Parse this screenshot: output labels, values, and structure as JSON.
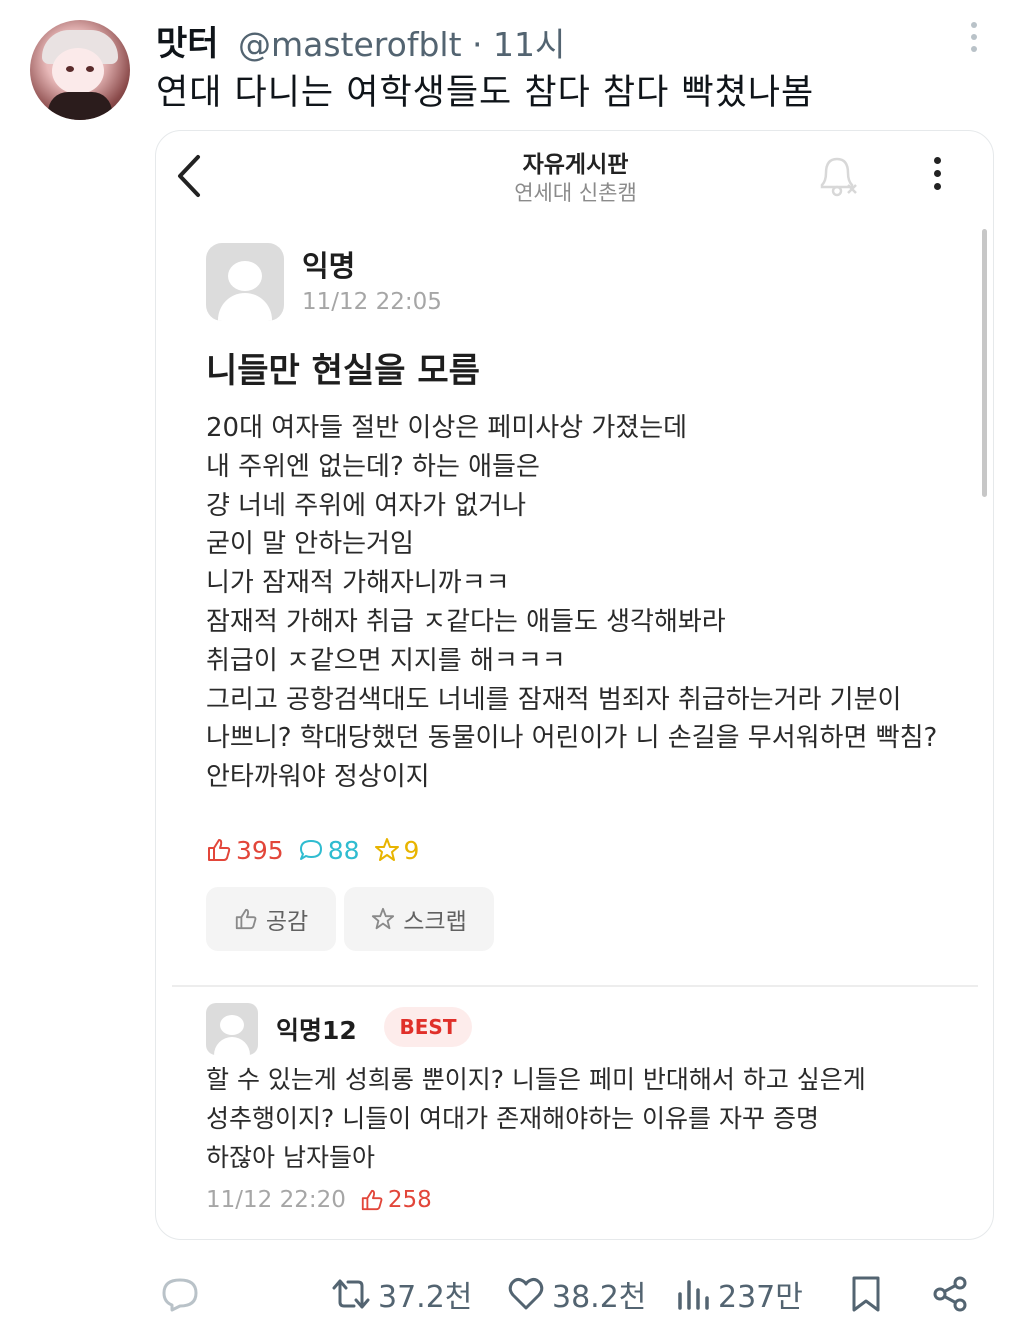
{
  "tweet": {
    "author_name": "맛터",
    "handle_time": "@masterofblt · 11시",
    "text": "연대 다니는 여학생들도 참다 참다 빡쳤나봄",
    "actions": {
      "retweets": "37.2천",
      "likes": "38.2천",
      "views": "237만"
    }
  },
  "screenshot": {
    "header": {
      "title": "자유게시판",
      "subtitle": "연세대 신촌캠"
    },
    "post": {
      "author": "익명",
      "time": "11/12 22:05",
      "title": "니들만 현실을 모름",
      "body_lines": [
        "20대 여자들 절반 이상은 페미사상 가졌는데",
        "내 주위엔 없는데? 하는 애들은",
        "걍 너네 주위에 여자가 없거나",
        "굳이 말 안하는거임",
        "니가 잠재적 가해자니까ㅋㅋ",
        "잠재적 가해자 취급 ㅈ같다는 애들도 생각해봐라",
        "취급이 ㅈ같으면 지지를 해ㅋㅋㅋ",
        "그리고 공항검색대도 너네를 잠재적 범죄자 취급하는거라 기분이",
        "나쁘니? 학대당했던 동물이나 어린이가 니 손길을 무서워하면 빡침?",
        "안타까워야 정상이지"
      ],
      "stats": {
        "likes": "395",
        "comments": "88",
        "scraps": "9"
      },
      "buttons": {
        "like_label": "공감",
        "scrap_label": "스크랩"
      }
    },
    "best_comment": {
      "author": "익명12",
      "badge": "BEST",
      "body_lines": [
        "할 수 있는게 성희롱 뿐이지? 니들은 페미 반대해서 하고 싶은게",
        "성추행이지? 니들이 여대가 존재해야하는 이유를 자꾸 증명",
        "하잖아 남자들아"
      ],
      "time": "11/12 22:20",
      "likes": "258"
    }
  },
  "colors": {
    "like_red": "#e2463a",
    "comment_teal": "#2fbcd0",
    "scrap_yellow": "#e8b400",
    "secondary_text": "#536471"
  },
  "icons": {
    "back": "chevron-left-icon",
    "bell_off": "bell-off-icon",
    "menu": "vertical-dots-icon",
    "thumb": "thumbs-up-icon",
    "comment": "speech-bubble-icon",
    "star": "star-icon",
    "reply": "reply-icon",
    "retweet": "retweet-icon",
    "heart": "heart-icon",
    "views": "bar-chart-icon",
    "bookmark": "bookmark-icon",
    "share": "share-icon"
  }
}
